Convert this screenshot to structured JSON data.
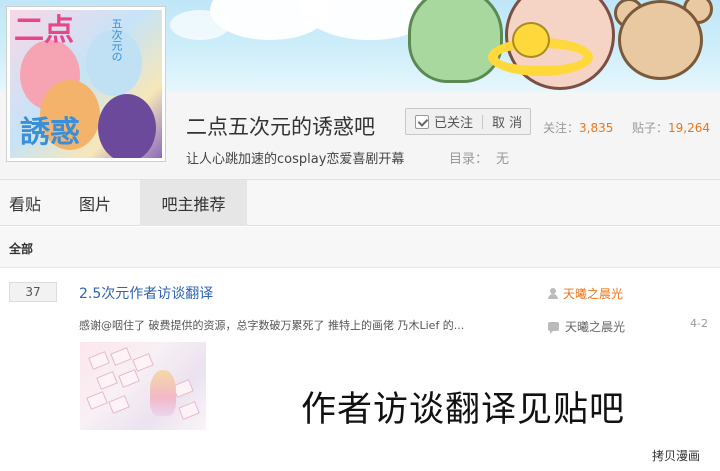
{
  "forum": {
    "name": "二点五次元的诱惑吧",
    "slogan": "让人心跳加速的cosplay恋爱喜剧开幕",
    "follow_label": "已关注",
    "cancel_label": "取 消",
    "followers_label": "关注：",
    "followers_count": "3,835",
    "posts_label": "贴子：",
    "posts_count": "19,264",
    "catalog_label": "目录：",
    "catalog_value": "无"
  },
  "cover": {
    "title_text_top": "二点",
    "title_text_bottom": "誘惑",
    "side_text": "五次元の"
  },
  "tabs": [
    {
      "label": "看贴",
      "active": false
    },
    {
      "label": "图片",
      "active": false
    },
    {
      "label": "吧主推荐",
      "active": true
    }
  ],
  "filter": {
    "label": "全部"
  },
  "thread": {
    "reply_count": "37",
    "title": "2.5次元作者访谈翻译",
    "author": "天曦之晨光",
    "abstract": "感谢@咽住了 破费提供的资源，总字数破万累死了 推特上的画佬 乃木Lief 的...",
    "last_reply_user": "天曦之晨光",
    "last_reply_date": "4-2"
  },
  "overlay_text": "作者访谈翻译见贴吧",
  "watermark": "拷贝漫画",
  "colors": {
    "accent_orange": "#e9761d",
    "link_blue": "#2d64b3"
  }
}
